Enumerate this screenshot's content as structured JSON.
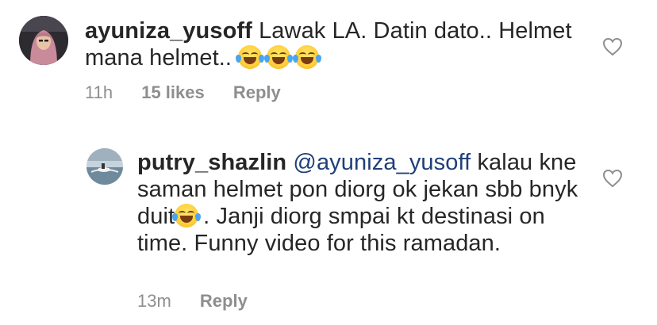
{
  "comments": [
    {
      "username": "ayuniza_yusoff",
      "text": "Lawak LA. Datin dato.. Helmet mana helmet..",
      "emoji": [
        "face-with-tears-of-joy",
        "face-with-tears-of-joy",
        "face-with-tears-of-joy"
      ],
      "time": "11h",
      "likes": "15 likes",
      "reply_label": "Reply"
    },
    {
      "username": "putry_shazlin",
      "mention": "@ayuniza_yusoff",
      "text_before_emoji": "kalau kne saman helmet pon diorg ok jekan sbb bnyk duit",
      "emoji": [
        "face-with-tears-of-joy"
      ],
      "text_after_emoji": ". Janji diorg smpai kt destinasi on time. Funny video for this ramadan.",
      "time": "13m",
      "reply_label": "Reply"
    }
  ],
  "colors": {
    "text": "#262626",
    "meta": "#8e8e8e",
    "mention": "#1f3f78"
  }
}
